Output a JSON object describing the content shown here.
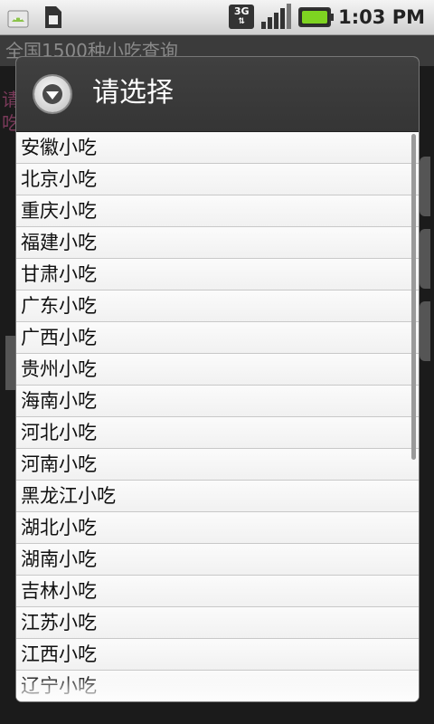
{
  "status_bar": {
    "time": "1:03 PM",
    "network_label": "3G",
    "icons": [
      "android-icon",
      "sim-card-icon",
      "network-3g-icon",
      "signal-icon",
      "battery-charging-icon"
    ]
  },
  "background_app": {
    "title": "全国1500种小吃查询",
    "body_text": "请\n吃"
  },
  "dialog": {
    "title": "请选择",
    "icon": "dropdown-circle-icon",
    "items": [
      "安徽小吃",
      "北京小吃",
      "重庆小吃",
      "福建小吃",
      "甘肃小吃",
      "广东小吃",
      "广西小吃",
      "贵州小吃",
      "海南小吃",
      "河北小吃",
      "河南小吃",
      "黑龙江小吃",
      "湖北小吃",
      "湖南小吃",
      "吉林小吃",
      "江苏小吃",
      "江西小吃",
      "辽宁小吃"
    ]
  }
}
